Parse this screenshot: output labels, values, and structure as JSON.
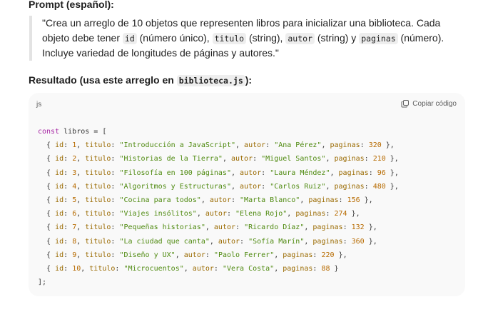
{
  "prompt": {
    "heading": "Prompt (español):",
    "quote": [
      {
        "t": "text",
        "v": "\"Crea un arreglo de 10 objetos que representen libros para inicializar una biblioteca. Cada objeto debe tener "
      },
      {
        "t": "code",
        "v": "id"
      },
      {
        "t": "text",
        "v": " (número único), "
      },
      {
        "t": "code",
        "v": "titulo"
      },
      {
        "t": "text",
        "v": " (string), "
      },
      {
        "t": "code",
        "v": "autor"
      },
      {
        "t": "text",
        "v": " (string) y "
      },
      {
        "t": "code",
        "v": "paginas"
      },
      {
        "t": "text",
        "v": " (número). Incluye variedad de longitudes de páginas y autores.\""
      }
    ]
  },
  "result": {
    "heading_prefix": "Resultado (usa este arreglo en ",
    "heading_file": "biblioteca.js",
    "heading_suffix": "):"
  },
  "codeblock": {
    "language": "js",
    "copy_label": "Copiar código",
    "keyword": "const",
    "var_name": "libros",
    "books": [
      {
        "id": 1,
        "titulo": "Introducción a JavaScript",
        "autor": "Ana Pérez",
        "paginas": 320
      },
      {
        "id": 2,
        "titulo": "Historias de la Tierra",
        "autor": "Miguel Santos",
        "paginas": 210
      },
      {
        "id": 3,
        "titulo": "Filosofía en 100 páginas",
        "autor": "Laura Méndez",
        "paginas": 96
      },
      {
        "id": 4,
        "titulo": "Algoritmos y Estructuras",
        "autor": "Carlos Ruiz",
        "paginas": 480
      },
      {
        "id": 5,
        "titulo": "Cocina para todos",
        "autor": "Marta Blanco",
        "paginas": 156
      },
      {
        "id": 6,
        "titulo": "Viajes insólitos",
        "autor": "Elena Rojo",
        "paginas": 274
      },
      {
        "id": 7,
        "titulo": "Pequeñas historias",
        "autor": "Ricardo Díaz",
        "paginas": 132
      },
      {
        "id": 8,
        "titulo": "La ciudad que canta",
        "autor": "Sofía Marín",
        "paginas": 360
      },
      {
        "id": 9,
        "titulo": "Diseño y UX",
        "autor": "Paolo Ferrer",
        "paginas": 220
      },
      {
        "id": 10,
        "titulo": "Microcuentos",
        "autor": "Vera Costa",
        "paginas": 88
      }
    ]
  }
}
